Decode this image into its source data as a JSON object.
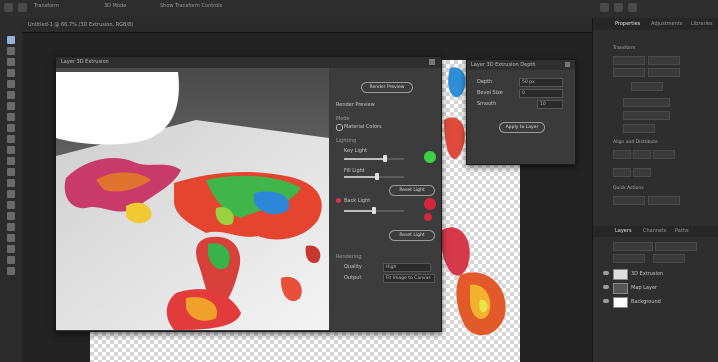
{
  "app": {
    "top_bar_items": [
      "Transform",
      "3D Mode",
      "Show Transform Controls"
    ],
    "doc_tab_title": "Untitled-1 @ 66.7% (3D Extrusion, RGB/8)",
    "colors": {
      "accent": "#8fb2d9",
      "panel": "#2e2e2e",
      "canvas_bg": "#232323"
    }
  },
  "tools": {
    "icons": [
      "move-icon",
      "marquee-icon",
      "lasso-icon",
      "quick-select-icon",
      "crop-icon",
      "frame-icon",
      "eyedropper-icon",
      "healing-icon",
      "brush-icon",
      "stamp-icon",
      "history-brush-icon",
      "eraser-icon",
      "gradient-icon",
      "blur-icon",
      "dodge-icon",
      "pen-icon",
      "type-icon",
      "path-select-icon",
      "rectangle-icon",
      "hand-icon",
      "zoom-icon",
      "more-icon"
    ],
    "selected_index": 0
  },
  "dialog": {
    "title": "Layer 3D Extrusion",
    "controls": {
      "header": "Render Preview",
      "section_mode": "Mode",
      "option_1": "Material Colors",
      "section_lighting": "Lighting",
      "light_1": "Key Light",
      "light_2": "Fill Light",
      "light_3": "Back Light",
      "btn_render": "Render Preview",
      "btn_reset_1": "Reset Light",
      "btn_reset_2": "Reset Light",
      "section_render": "Rendering",
      "quality_label": "Quality",
      "quality_value": "High",
      "output_label": "Output",
      "output_value": "Fit Image to Canvas",
      "key_value": 0.68,
      "fill_value": 0.55,
      "back_value": 0.5,
      "key_color": "#39d343",
      "fill_color": "#d4283a",
      "back_color": "#cf2a3a"
    }
  },
  "dialog2": {
    "title": "Layer 3D Extrusion Depth",
    "rows": [
      {
        "label": "Depth",
        "value": "50 px"
      },
      {
        "label": "Bevel Size",
        "value": "0"
      },
      {
        "label": "Smooth",
        "value": "10"
      }
    ],
    "apply_label": "Apply to Layer"
  },
  "right_panel": {
    "tabs": [
      "Properties",
      "Adjustments",
      "Libraries"
    ],
    "active_tab": 0,
    "sections": [
      "Transform",
      "Align and Distribute",
      "Quick Actions"
    ],
    "layers_tabs": [
      "Layers",
      "Channels",
      "Paths"
    ],
    "layers": [
      {
        "name": "3D Extrusion",
        "visible": true
      },
      {
        "name": "Map Layer",
        "visible": true
      },
      {
        "name": "Background",
        "visible": true
      }
    ]
  }
}
